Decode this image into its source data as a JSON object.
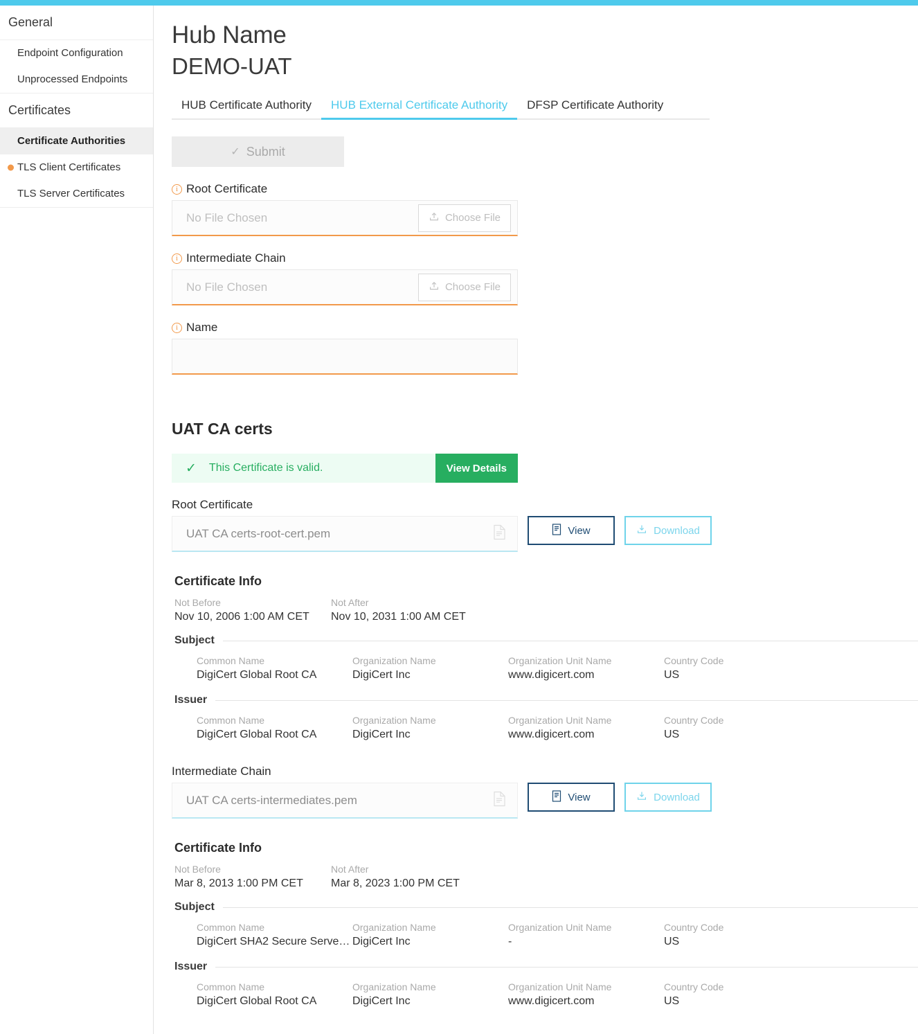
{
  "sidebar": {
    "groups": [
      {
        "title": "General",
        "items": [
          {
            "label": "Endpoint Configuration",
            "active": false,
            "dot": false
          },
          {
            "label": "Unprocessed Endpoints",
            "active": false,
            "dot": false
          }
        ]
      },
      {
        "title": "Certificates",
        "items": [
          {
            "label": "Certificate Authorities",
            "active": true,
            "dot": false
          },
          {
            "label": "TLS Client Certificates",
            "active": false,
            "dot": true
          },
          {
            "label": "TLS Server Certificates",
            "active": false,
            "dot": false
          }
        ]
      }
    ]
  },
  "header": {
    "hub_label": "Hub Name",
    "hub_value": "DEMO-UAT"
  },
  "tabs": [
    {
      "label": "HUB Certificate Authority",
      "active": false
    },
    {
      "label": "HUB External Certificate Authority",
      "active": true
    },
    {
      "label": "DFSP Certificate Authority",
      "active": false
    }
  ],
  "form": {
    "submit_label": "Submit",
    "submit_check": "✓",
    "fields": [
      {
        "label": "Root Certificate",
        "placeholder": "No File Chosen",
        "button_label": "Choose File",
        "type": "file"
      },
      {
        "label": "Intermediate Chain",
        "placeholder": "No File Chosen",
        "button_label": "Choose File",
        "type": "file"
      },
      {
        "label": "Name",
        "value": "",
        "placeholder": "",
        "type": "text"
      }
    ]
  },
  "certs_section": {
    "title": "UAT CA certs",
    "banner": {
      "message": "This Certificate is valid.",
      "tick": "✓",
      "button_label": "View Details"
    },
    "root": {
      "label": "Root Certificate",
      "file_name": "UAT CA certs-root-cert.pem",
      "view_label": "View",
      "download_label": "Download",
      "info": {
        "title": "Certificate Info",
        "not_before_label": "Not Before",
        "not_before_value": "Nov 10, 2006 1:00 AM CET",
        "not_after_label": "Not After",
        "not_after_value": "Nov 10, 2031 1:00 AM CET",
        "subject_label": "Subject",
        "issuer_label": "Issuer",
        "col_labels": [
          "Common Name",
          "Organization Name",
          "Organization Unit Name",
          "Country Code"
        ],
        "subject_values": [
          "DigiCert Global Root CA",
          "DigiCert Inc",
          "www.digicert.com",
          "US"
        ],
        "issuer_values": [
          "DigiCert Global Root CA",
          "DigiCert Inc",
          "www.digicert.com",
          "US"
        ]
      }
    },
    "intermediate": {
      "label": "Intermediate Chain",
      "file_name": "UAT CA certs-intermediates.pem",
      "view_label": "View",
      "download_label": "Download",
      "info": {
        "title": "Certificate Info",
        "not_before_label": "Not Before",
        "not_before_value": "Mar 8, 2013 1:00 PM CET",
        "not_after_label": "Not After",
        "not_after_value": "Mar 8, 2023 1:00 PM CET",
        "subject_label": "Subject",
        "issuer_label": "Issuer",
        "col_labels": [
          "Common Name",
          "Organization Name",
          "Organization Unit Name",
          "Country Code"
        ],
        "subject_values": [
          "DigiCert SHA2 Secure Serve…",
          "DigiCert Inc",
          "-",
          "US"
        ],
        "issuer_values": [
          "DigiCert Global Root CA",
          "DigiCert Inc",
          "www.digicert.com",
          "US"
        ]
      }
    }
  },
  "colors": {
    "accent": "#4ECAEC",
    "warning": "#F2994A",
    "success": "#27AE60",
    "navy": "#1F4C73"
  }
}
